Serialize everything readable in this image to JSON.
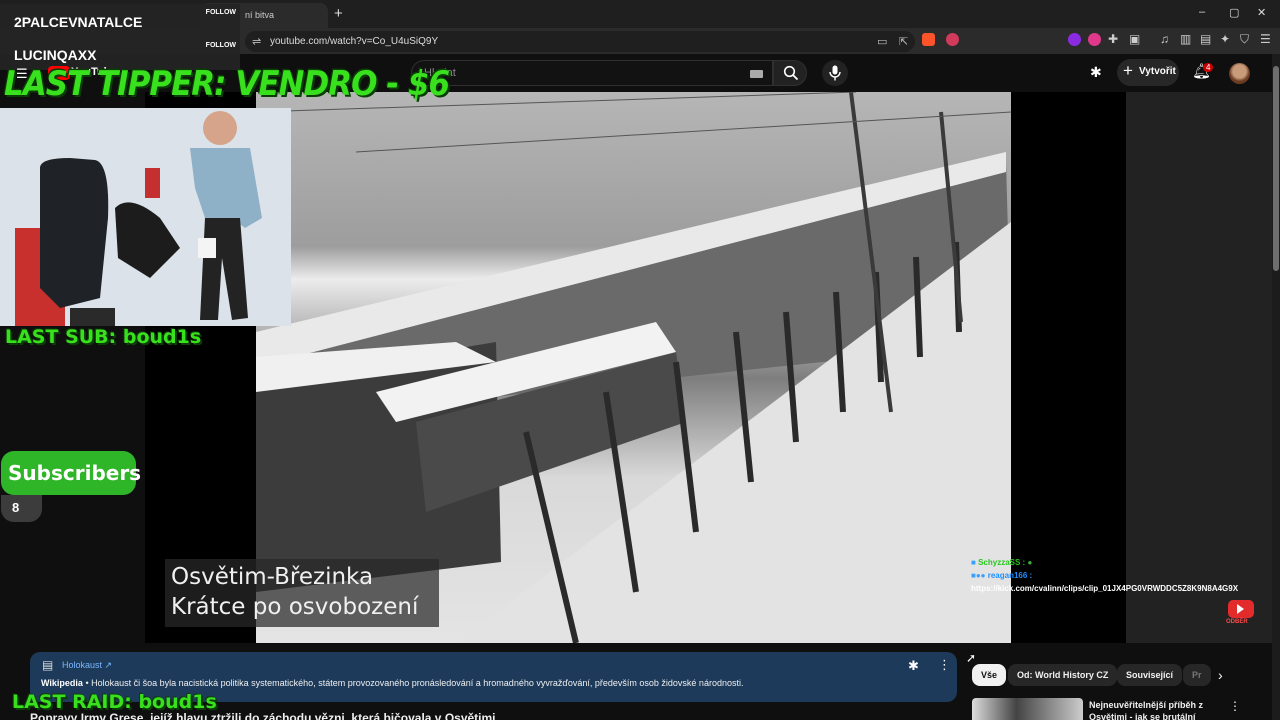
{
  "browser": {
    "tab_title": "ní bitva",
    "new_tab": "+",
    "url": "youtube.com/watch?v=Co_U4uSiQ9Y",
    "window_controls": [
      "–",
      "▢",
      "✕"
    ]
  },
  "youtube": {
    "logo_text": "YouTube",
    "search_placeholder": "Hledat",
    "create_label": "Vytvořit",
    "notification_count": "4",
    "video_caption_line1": "Osvětim-Březinka",
    "video_caption_line2": "Krátce po osvobození",
    "info_card": {
      "title": "Holokaust ↗",
      "source": "Wikipedia",
      "text": " • Holokaust či šoa byla nacistická politika systematického, státem provozovaného pronásledování a hromadného vyvražďování, především osob židovské národnosti."
    },
    "below_title": "Popravy Irmy Grese, jejíž hlavu ztržili do záchodu vězni, která bičovala v Osvětimi",
    "chips": [
      "Vše",
      "Od: World History CZ",
      "Související",
      "Pr"
    ],
    "recommendation_title_1": "Nejneuvěřitelnější příběh z",
    "recommendation_title_2": "Osvětimi - jak se brutální"
  },
  "overlay": {
    "follower_1": "2PALCEVNATALCE",
    "follower_2": "LUCINQAXX",
    "follow_label": "FOLLOW",
    "last_tipper": "LAST TIPPER: VENDRO - $6",
    "last_sub": "LAST SUB: boud1s",
    "subscribers_label": "Subscribers",
    "subscribers_count": "8",
    "last_raid": "LAST RAID: boud1s",
    "chat": {
      "user1": "SchyzzaSS :",
      "user2": "reagan166 :",
      "link": "https://kick.com/cvalinn/clips/clip_01JX4PG0VRWDDC5Z8K9N8A4G9X"
    },
    "odber_label": "ODBĚR"
  },
  "colors": {
    "accent_green": "#39e01d",
    "youtube_red": "#ff0000",
    "info_card_bg": "#1d3a5a",
    "link_blue": "#7ab7ff"
  }
}
